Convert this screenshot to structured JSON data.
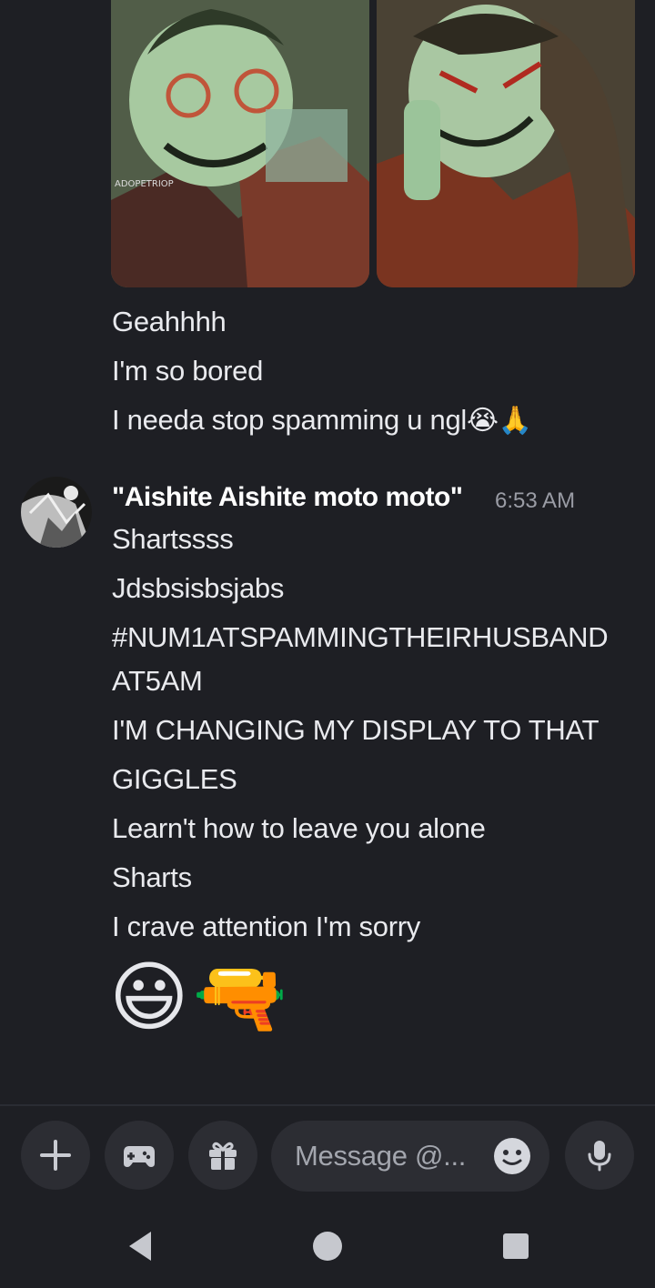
{
  "chat": {
    "message_group_1": {
      "lines": [
        "Geahhhh",
        "I'm so bored",
        "I needa stop spamming u ngl"
      ],
      "line3_emojis": "😭🙏"
    },
    "message_group_2": {
      "username": "\"Aishite Aishite moto moto\"",
      "timestamp": "6:53 AM",
      "lines": [
        "Shartssss",
        "Jdsbsisbsjabs",
        "#NUM1ATSPAMMINGTHEIRHUSBAND",
        "AT5AM",
        "I'M CHANGING MY DISPLAY TO THAT",
        "GIGGLES",
        "Learn't how to leave you alone",
        "Sharts",
        "I crave attention I'm sorry"
      ],
      "big_emojis": [
        "😃",
        "🔫"
      ]
    }
  },
  "composer": {
    "placeholder": "Message @...",
    "buttons": [
      "plus-icon",
      "gamepad-icon",
      "gift-icon",
      "microphone-icon"
    ],
    "emoji_button": "smiley-icon"
  },
  "navbar": [
    "back-icon",
    "home-icon",
    "recents-icon"
  ],
  "colors": {
    "background": "#1e1f24",
    "button_bg": "#2c2d33",
    "text": "#e9eaee",
    "muted": "#9a9ca5"
  }
}
